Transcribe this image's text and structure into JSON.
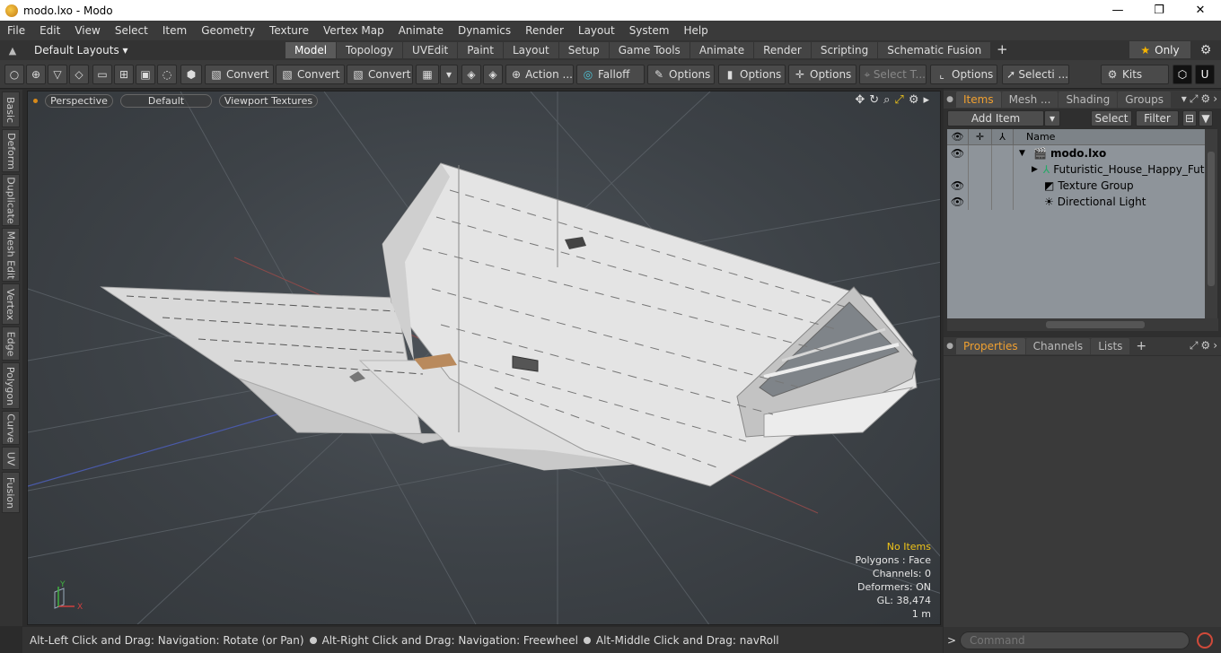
{
  "window": {
    "title": "modo.lxo - Modo",
    "controls": [
      "—",
      "❐",
      "✕"
    ]
  },
  "menu": [
    "File",
    "Edit",
    "View",
    "Select",
    "Item",
    "Geometry",
    "Texture",
    "Vertex Map",
    "Animate",
    "Dynamics",
    "Render",
    "Layout",
    "System",
    "Help"
  ],
  "layouts": {
    "selector": "Default Layouts ▾",
    "tabs": [
      "Model",
      "Topology",
      "UVEdit",
      "Paint",
      "Layout",
      "Setup",
      "Game Tools",
      "Animate",
      "Render",
      "Scripting",
      "Schematic Fusion"
    ],
    "active": "Model",
    "only_label": "Only"
  },
  "toolbar": {
    "convert1": "Convert",
    "convert2": "Convert",
    "convert3": "Convert",
    "action": "Action ...",
    "falloff": "Falloff",
    "options1": "Options",
    "options2": "Options",
    "options3": "Options",
    "select_t": "Select T...",
    "options4": "Options",
    "selecti": "Selecti ...",
    "kits": "Kits"
  },
  "left_tabs": [
    "Basic",
    "Deform",
    "Duplicate",
    "Mesh Edit",
    "Vertex",
    "Edge",
    "Polygon",
    "Curve",
    "UV",
    "Fusion"
  ],
  "viewport": {
    "view": "Perspective",
    "shading": "Default",
    "textures": "Viewport Textures",
    "stats": {
      "selection": "No Items",
      "polygons": "Polygons : Face",
      "channels": "Channels: 0",
      "deformers": "Deformers: ON",
      "gl": "GL: 38,474",
      "scale": "1 m"
    },
    "axis": {
      "x": "X",
      "y": "Y"
    }
  },
  "status": {
    "hint1": "Alt-Left Click and Drag: Navigation: Rotate (or Pan)",
    "hint2": "Alt-Right Click and Drag: Navigation: Freewheel",
    "hint3": "Alt-Middle Click and Drag: navRoll"
  },
  "items_panel": {
    "tabs": [
      "Items",
      "Mesh ...",
      "Shading",
      "Groups"
    ],
    "active": "Items",
    "add_item": "Add Item",
    "select": "Select",
    "filter": "Filter",
    "name_header": "Name",
    "tree": [
      {
        "name": "modo.lxo",
        "bold": true,
        "visible": true
      },
      {
        "name": "Futuristic_House_Happy_Future",
        "visible": false
      },
      {
        "name": "Texture Group",
        "visible": true
      },
      {
        "name": "Directional Light",
        "visible": true
      }
    ]
  },
  "props_panel": {
    "tabs": [
      "Properties",
      "Channels",
      "Lists"
    ],
    "active": "Properties"
  },
  "command": {
    "placeholder": "Command",
    "prompt": ">"
  },
  "colors": {
    "accent": "#f0a030",
    "viewport_bg": "#3d4247",
    "tree_bg": "#8e949a"
  }
}
